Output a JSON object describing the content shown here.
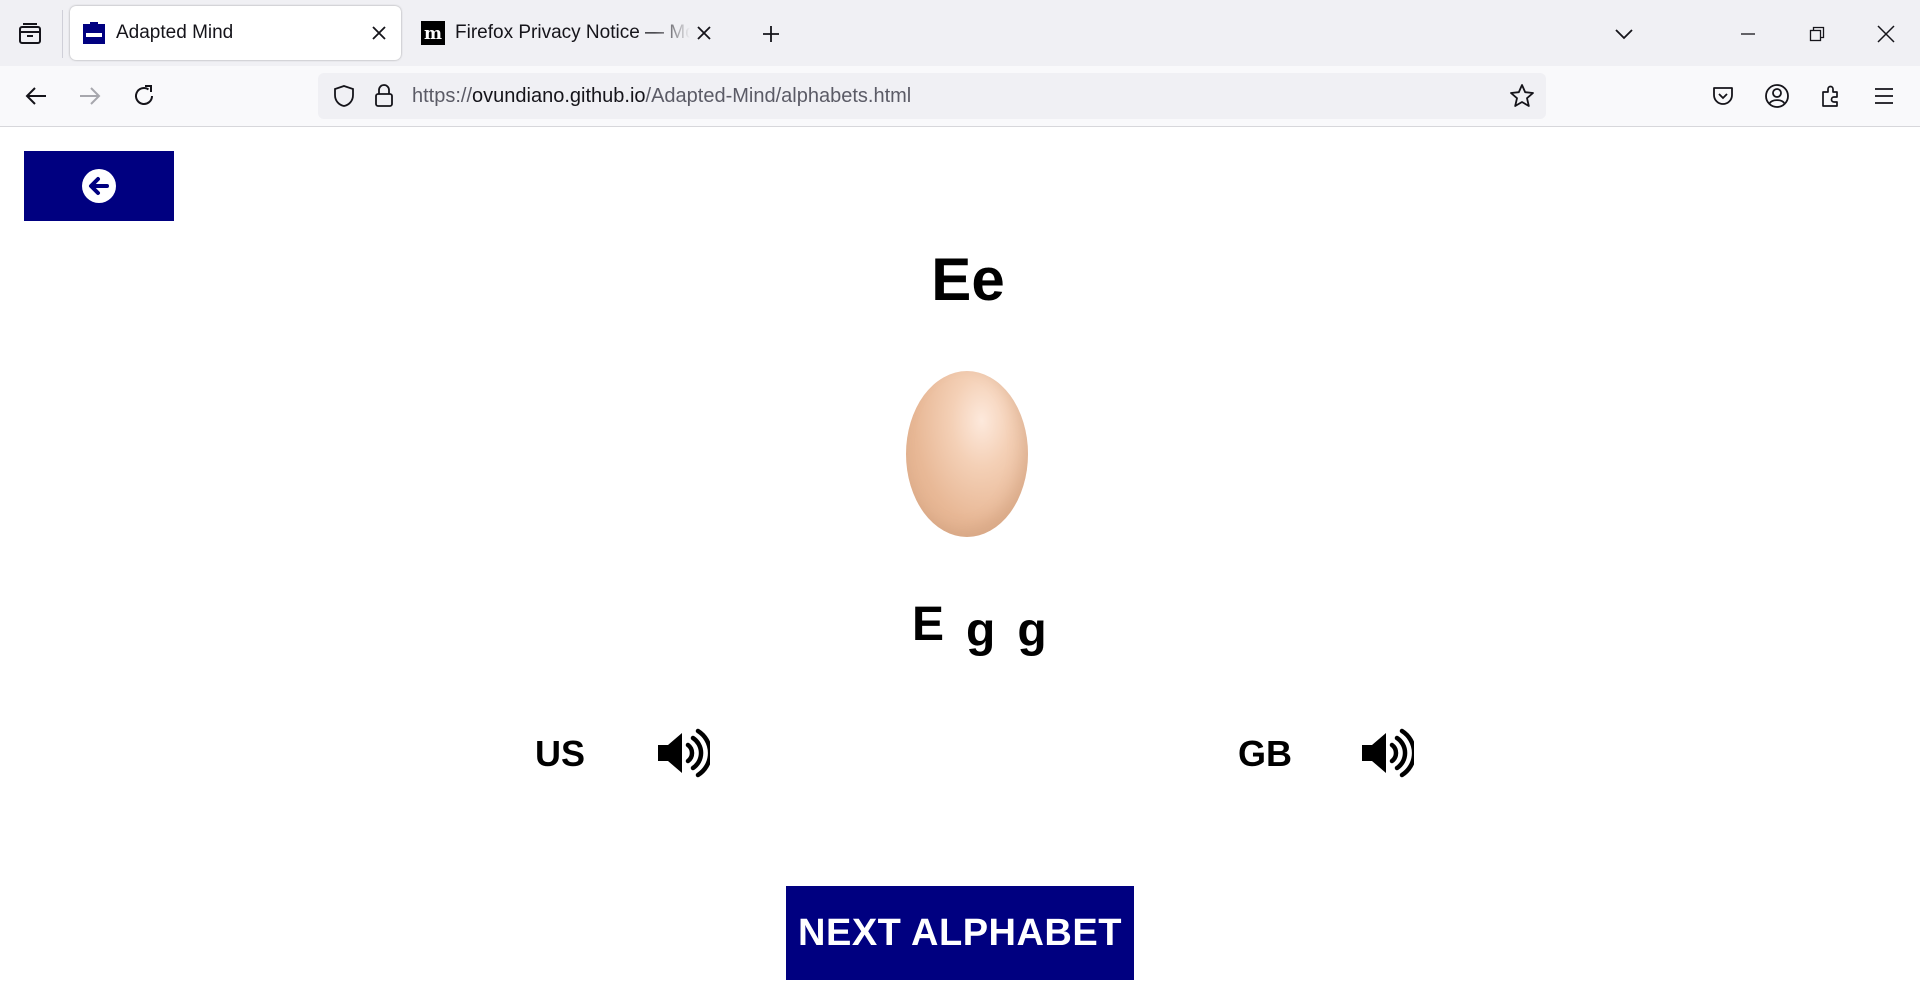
{
  "browser": {
    "tabs": [
      {
        "title": "Adapted Mind",
        "active": true,
        "favicon": "adapted-mind-favicon"
      },
      {
        "title": "Firefox Privacy Notice — Mozilla",
        "active": false,
        "favicon": "mozilla-m-favicon"
      }
    ],
    "url": {
      "scheme": "https://",
      "host": "ovundiano.github.io",
      "path": "/Adapted-Mind/alphabets.html"
    },
    "colors": {
      "tabstrip": "#f0f0f4",
      "navbar": "#f9f9fb"
    }
  },
  "page": {
    "letter": "Ee",
    "image": "egg",
    "word_letters": [
      "E",
      "g",
      "g"
    ],
    "accents": [
      {
        "label": "US",
        "icon": "speaker-icon"
      },
      {
        "label": "GB",
        "icon": "speaker-icon"
      }
    ],
    "next_button": "NEXT ALPHABET",
    "back_button_icon": "arrow-left-circle-icon",
    "colors": {
      "button_bg": "#000080",
      "button_text": "#ffffff",
      "text": "#000000"
    }
  }
}
